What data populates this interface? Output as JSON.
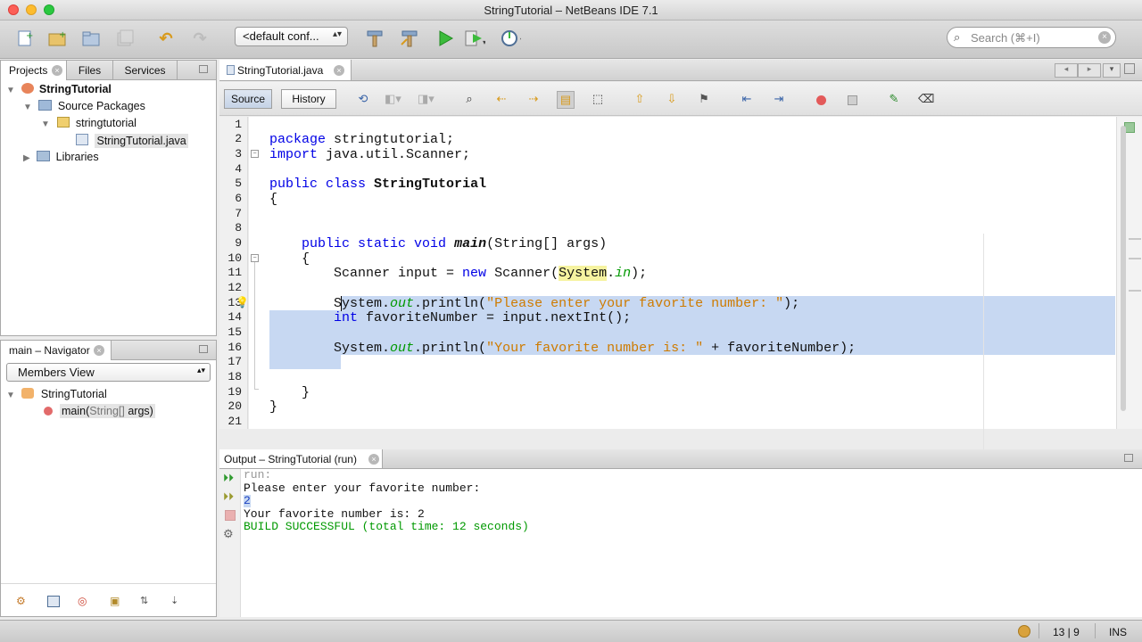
{
  "window": {
    "title": "StringTutorial – NetBeans IDE 7.1"
  },
  "toolbar": {
    "config_value": "<default conf...",
    "search_placeholder": "Search (⌘+I)"
  },
  "projects_panel": {
    "tabs": [
      "Projects",
      "Files",
      "Services"
    ],
    "tree": [
      {
        "label": "StringTutorial",
        "icon": "project-icon",
        "bold": true
      },
      {
        "label": "Source Packages",
        "icon": "source-folder-icon"
      },
      {
        "label": "stringtutorial",
        "icon": "package-icon"
      },
      {
        "label": "StringTutorial.java",
        "icon": "java-file-icon"
      },
      {
        "label": "Libraries",
        "icon": "library-icon"
      }
    ]
  },
  "navigator": {
    "title": "main – Navigator",
    "view_select": "Members View",
    "class_name": "StringTutorial",
    "member_name": "main(",
    "member_params": "String[]",
    "member_rest": " args)"
  },
  "editor": {
    "tab_label": "StringTutorial.java",
    "source_label": "Source",
    "history_label": "History",
    "line_numbers": [
      "1",
      "2",
      "3",
      "4",
      "5",
      "6",
      "7",
      "8",
      "9",
      "10",
      "11",
      "12",
      "13",
      "14",
      "15",
      "16",
      "17",
      "18",
      "19",
      "20",
      "21"
    ],
    "code": {
      "l2_kw": "package",
      "l2_rest": " stringtutorial;",
      "l3_kw": "import",
      "l3_rest": " java.util.Scanner;",
      "l5_kw": "public class",
      "l5_name": "StringTutorial",
      "l6": "{",
      "l9_kw": "public static void",
      "l9_name": "main",
      "l9_rest": "(String[] args)",
      "l10": "{",
      "l11_a": "Scanner input = ",
      "l11_kw": "new",
      "l11_b": " Scanner(",
      "l11_sys": "System",
      "l11_dot": ".",
      "l11_in": "in",
      "l11_end": ");",
      "l13_a": "System.",
      "l13_out": "out",
      "l13_b": ".println(",
      "l13_str": "\"Please enter your favorite number: \"",
      "l13_end": ");",
      "l14_kw": "int",
      "l14_rest": " favoriteNumber = input.nextInt();",
      "l16_a": "System.",
      "l16_out": "out",
      "l16_b": ".println(",
      "l16_str": "\"Your favorite number is: \"",
      "l16_end": " + favoriteNumber);",
      "l19": "}",
      "l20": "}"
    }
  },
  "output": {
    "tab_label": "Output – StringTutorial (run)",
    "lines": [
      "run:",
      "Please enter your favorite number:",
      "2",
      "Your favorite number is: 2",
      "BUILD SUCCESSFUL (total time: 12 seconds)"
    ]
  },
  "statusbar": {
    "position": "13 | 9",
    "mode": "INS"
  },
  "colors": {
    "keyword": "#0000e6",
    "string": "#ce7b00",
    "field": "#009900",
    "selection": "#c7d8f2",
    "build_success": "#009900"
  }
}
